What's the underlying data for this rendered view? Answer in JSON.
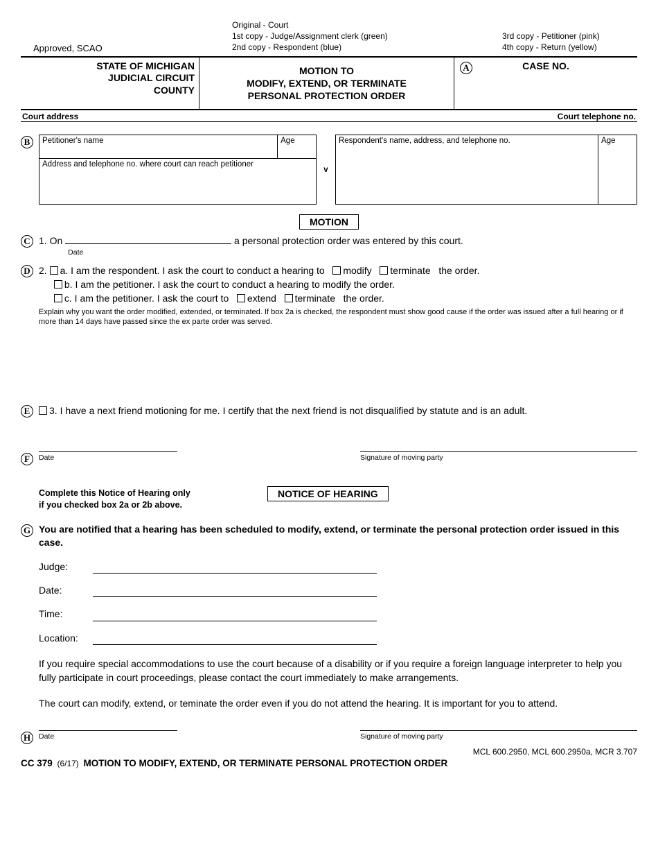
{
  "top": {
    "approved": "Approved, SCAO",
    "copies_left": [
      "Original - Court",
      "1st copy - Judge/Assignment clerk (green)",
      "2nd copy - Respondent (blue)"
    ],
    "copies_right": [
      "3rd copy - Petitioner (pink)",
      "4th copy - Return (yellow)"
    ]
  },
  "header": {
    "state": "STATE OF MICHIGAN",
    "court1": "JUDICIAL CIRCUIT",
    "court2": "COUNTY",
    "title1": "MOTION TO",
    "title2": "MODIFY, EXTEND, OR TERMINATE",
    "title3": "PERSONAL PROTECTION ORDER",
    "caseno": "CASE NO."
  },
  "addr": {
    "left": "Court address",
    "right": "Court telephone no."
  },
  "markers": {
    "A": "A",
    "B": "B",
    "C": "C",
    "D": "D",
    "E": "E",
    "F": "F",
    "G": "G",
    "H": "H"
  },
  "parties": {
    "pet_name": "Petitioner's name",
    "age": "Age",
    "pet_addr": "Address and telephone no. where court can reach petitioner",
    "v": "v",
    "resp_name": "Respondent's name, address, and telephone no."
  },
  "motion_label": "MOTION",
  "c_line": {
    "prefix": "1.  On",
    "date_label": "Date",
    "suffix": "a personal protection order was entered by this court."
  },
  "d_block": {
    "num": "2.",
    "a_pre": "a. I am the respondent. I ask the court to conduct a hearing to",
    "modify": "modify",
    "terminate": "terminate",
    "the_order": "the order.",
    "b": "b. I am the petitioner. I ask the court to conduct a hearing to modify the order.",
    "c_pre": "c. I am the petitioner. I ask the court to",
    "extend": "extend",
    "explain": "Explain why you want the order modified, extended, or terminated. If box 2a is checked, the respondent must show good cause if the order was issued after a full hearing or if more than 14 days have passed since the ex parte order was served."
  },
  "e_line": "3. I have a next friend motioning for me. I certify that the next friend is not disqualified by statute and is an adult.",
  "sig": {
    "date": "Date",
    "sig": "Signature of moving party"
  },
  "noh": {
    "instr1": "Complete this Notice of Hearing only",
    "instr2": "if you checked box 2a or 2b above.",
    "title": "NOTICE OF HEARING",
    "body": "You are notified that a hearing has been scheduled to modify, extend, or terminate the personal protection order issued in this case.",
    "judge": "Judge:",
    "date": "Date:",
    "time": "Time:",
    "location": "Location:",
    "accom": "If you require special accommodations to use the court because of a disability or if you require a foreign language interpreter to help you fully participate in court proceedings, please contact the court immediately to make arrangements.",
    "attend": "The court can modify, extend, or teminate the order even if you do not attend the hearing. It is important for you to attend."
  },
  "footer": {
    "cite": "MCL 600.2950, MCL 600.2950a, MCR 3.707",
    "form": "CC 379",
    "rev": "(6/17)",
    "title": "MOTION TO MODIFY, EXTEND, OR TERMINATE PERSONAL PROTECTION ORDER"
  }
}
